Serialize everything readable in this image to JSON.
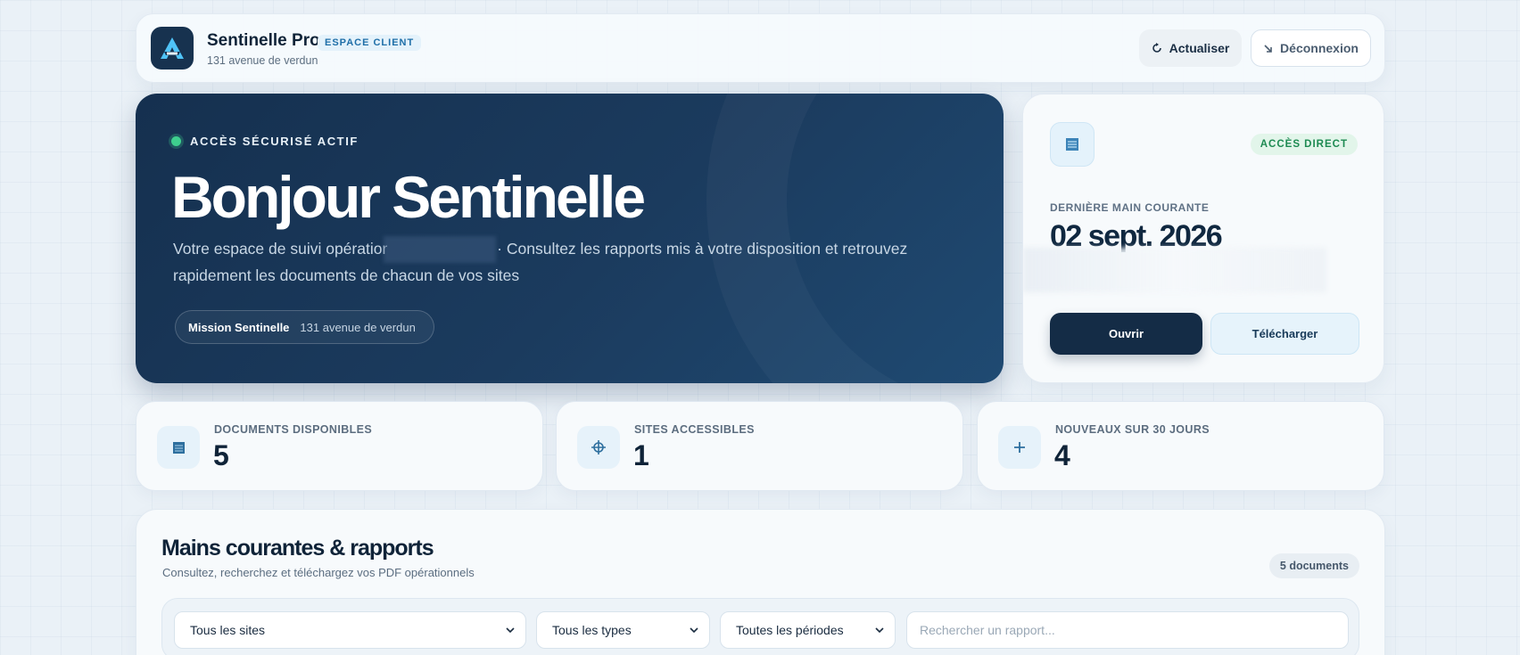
{
  "header": {
    "brand_name": "Sentinelle Pro",
    "badge": "ESPACE CLIENT",
    "subtitle": "131 avenue de verdun",
    "refresh_label": "Actualiser",
    "logout_label": "Déconnexion"
  },
  "hero": {
    "status": "ACCÈS SÉCURISÉ ACTIF",
    "title": "Bonjour Sentinelle",
    "text_before": "Votre espace de suivi opératior",
    "text_after": "· Consultez les rapports mis à votre disposition et retrouvez rapidement les documents de chacun de vos sites",
    "mission_name": "Mission Sentinelle",
    "mission_address": "131 avenue de verdun"
  },
  "latest": {
    "badge": "ACCÈS DIRECT",
    "label": "DERNIÈRE MAIN COURANTE",
    "date": "02 sept. 2026",
    "open_label": "Ouvrir",
    "download_label": "Télécharger"
  },
  "stats": [
    {
      "label": "DOCUMENTS DISPONIBLES",
      "value": "5",
      "icon": "document-icon"
    },
    {
      "label": "SITES ACCESSIBLES",
      "value": "1",
      "icon": "crosshair-icon"
    },
    {
      "label": "NOUVEAUX SUR 30 JOURS",
      "value": "4",
      "icon": "plus-icon"
    }
  ],
  "reports": {
    "title": "Mains courantes & rapports",
    "subtitle": "Consultez, recherchez et téléchargez vos PDF opérationnels",
    "count": "5 documents",
    "filter_sites": "Tous les sites",
    "filter_types": "Tous les types",
    "filter_periods": "Toutes les périodes",
    "search_placeholder": "Rechercher un rapport..."
  },
  "colors": {
    "hero_bg": "#15304f",
    "accent": "#1f6fa8",
    "success": "#3ecf8e",
    "primary_button": "#142c46"
  }
}
